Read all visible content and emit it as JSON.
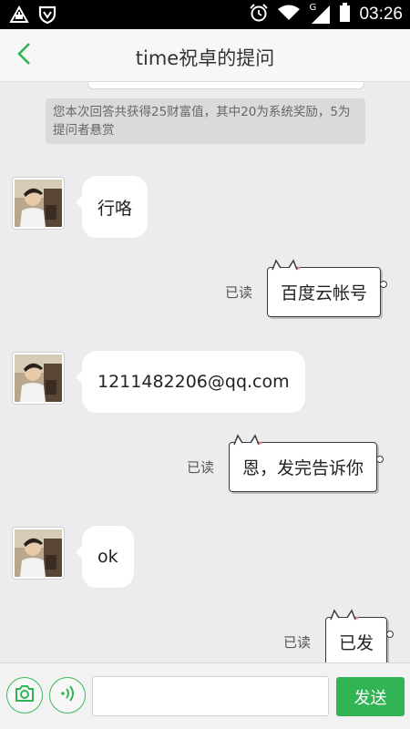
{
  "status_bar": {
    "time": "03:26",
    "network_type": "G",
    "icons": [
      "drive-warning-icon",
      "shield-icon",
      "alarm-clock-icon",
      "wifi-icon",
      "signal-icon",
      "battery-icon"
    ]
  },
  "header": {
    "title": "time祝卓的提问",
    "back_icon": "chevron-left-icon"
  },
  "system_notice": {
    "text": "您本次回答共获得25财富值，其中20为系统奖励，5为提问者悬赏"
  },
  "messages": [
    {
      "side": "in",
      "text": "行咯"
    },
    {
      "side": "out",
      "text": "百度云帐号",
      "status": "已读"
    },
    {
      "side": "in",
      "text": "1211482206@qq.com"
    },
    {
      "side": "out",
      "text": "恩，发完告诉你",
      "status": "已读"
    },
    {
      "side": "in",
      "text": "ok"
    },
    {
      "side": "out",
      "text": "已发",
      "status": "已读"
    }
  ],
  "input_bar": {
    "camera_icon": "camera-icon",
    "voice_icon": "voice-icon",
    "placeholder": "",
    "value": "",
    "send_label": "发送"
  },
  "colors": {
    "accent": "#31b454",
    "background": "#ececec",
    "status_bar": "#000000"
  }
}
